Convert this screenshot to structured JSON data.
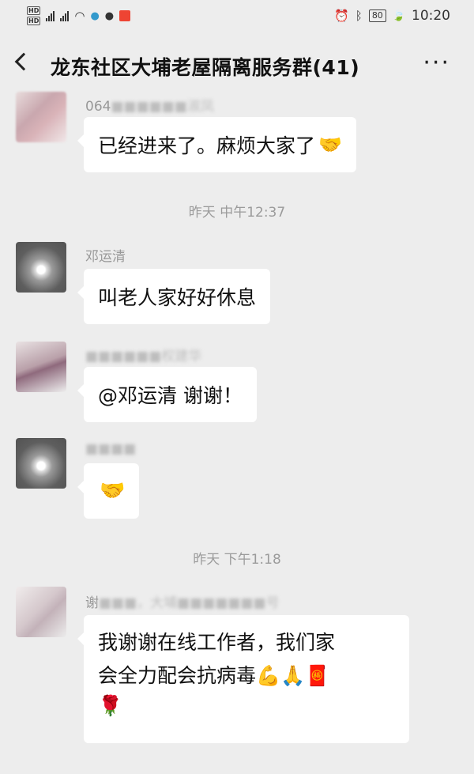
{
  "status_bar": {
    "time": "10:20",
    "battery": "80",
    "hd_labels": [
      "HD",
      "HD"
    ]
  },
  "navbar": {
    "title": "龙东社区大埔老屋隔离服务群(41)",
    "more": "···"
  },
  "messages": [
    {
      "sender": "064",
      "sender_blurred": "■■■■■■淑凤",
      "text": "已经进来了。麻烦大家了",
      "emoji": "🤝"
    },
    {
      "time_divider": "昨天 中午12:37"
    },
    {
      "sender": "邓运清",
      "text": "叫老人家好好休息"
    },
    {
      "sender_blurred": "■■■■■■权建华",
      "text": "@邓运清  谢谢！"
    },
    {
      "sender_blurred": "■■■■",
      "emoji": "🤝"
    },
    {
      "time_divider": "昨天 下午1:18"
    },
    {
      "sender": "谢",
      "sender_blurred": "■■■，大埔■■■■■■■号",
      "lines": [
        "我谢谢在线工作者，我们家",
        "会全力配会抗病毒💪🙏🧧",
        "🌹"
      ]
    }
  ]
}
